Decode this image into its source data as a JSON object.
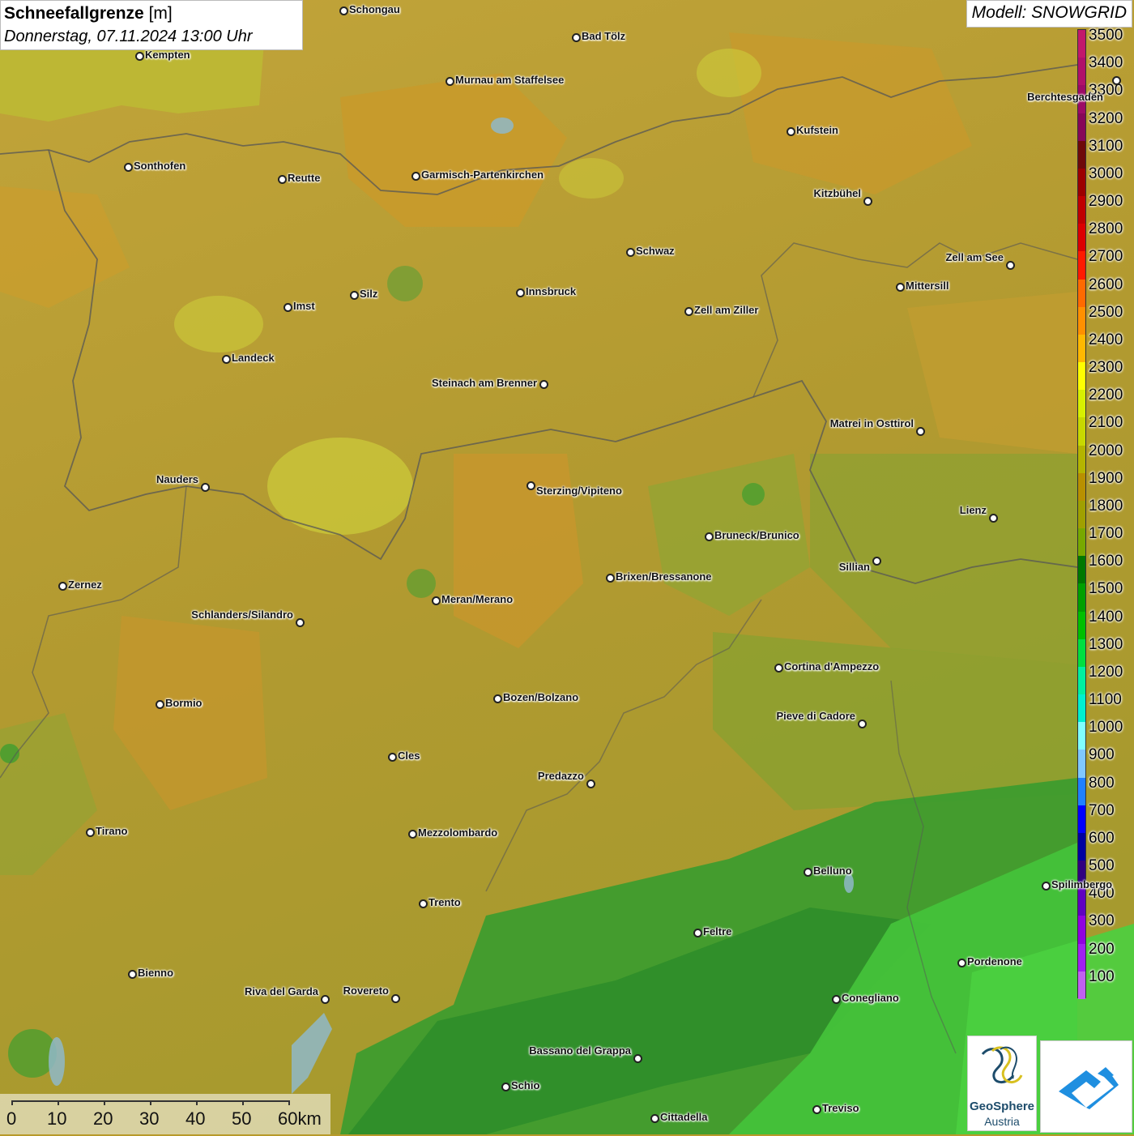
{
  "header": {
    "title_bold": "Schneefallgrenze",
    "title_unit": " [m]",
    "subtitle": "Donnerstag, 07.11.2024 13:00 Uhr",
    "model": "Modell: SNOWGRID"
  },
  "legend": {
    "levels": [
      {
        "label": "3500",
        "color": "#c2186b"
      },
      {
        "label": "3400",
        "color": "#b0106a"
      },
      {
        "label": "3300",
        "color": "#9c0a66"
      },
      {
        "label": "3200",
        "color": "#860658"
      },
      {
        "label": "3100",
        "color": "#6e0a0a"
      },
      {
        "label": "3000",
        "color": "#9c0000"
      },
      {
        "label": "2900",
        "color": "#c00000"
      },
      {
        "label": "2800",
        "color": "#dc0000"
      },
      {
        "label": "2700",
        "color": "#ff1a00"
      },
      {
        "label": "2600",
        "color": "#ff6a00"
      },
      {
        "label": "2500",
        "color": "#ff9000"
      },
      {
        "label": "2400",
        "color": "#ffb800"
      },
      {
        "label": "2300",
        "color": "#ffff00"
      },
      {
        "label": "2200",
        "color": "#d8f000"
      },
      {
        "label": "2100",
        "color": "#c8d800"
      },
      {
        "label": "2000",
        "color": "#b4b400"
      },
      {
        "label": "1900",
        "color": "#b89000"
      },
      {
        "label": "1800",
        "color": "#a0a000"
      },
      {
        "label": "1700",
        "color": "#78a800"
      },
      {
        "label": "1600",
        "color": "#007800"
      },
      {
        "label": "1500",
        "color": "#00a000"
      },
      {
        "label": "1400",
        "color": "#00c000"
      },
      {
        "label": "1300",
        "color": "#00e040"
      },
      {
        "label": "1200",
        "color": "#00f0a0"
      },
      {
        "label": "1100",
        "color": "#00f0d0"
      },
      {
        "label": "1000",
        "color": "#80ffff"
      },
      {
        "label": "900",
        "color": "#80c8ff"
      },
      {
        "label": "800",
        "color": "#2080ff"
      },
      {
        "label": "700",
        "color": "#0000ff"
      },
      {
        "label": "600",
        "color": "#0000a0"
      },
      {
        "label": "500",
        "color": "#300080"
      },
      {
        "label": "400",
        "color": "#6000c0"
      },
      {
        "label": "300",
        "color": "#9000e0"
      },
      {
        "label": "200",
        "color": "#a020f0"
      },
      {
        "label": "100",
        "color": "#c060f0"
      }
    ]
  },
  "cities": [
    {
      "name": "Schongau"
    },
    {
      "name": "Bad Tölz"
    },
    {
      "name": "Kempten"
    },
    {
      "name": "Murnau am Staffelsee"
    },
    {
      "name": "Berchtesgaden"
    },
    {
      "name": "Kufstein"
    },
    {
      "name": "Sonthofen"
    },
    {
      "name": "Reutte"
    },
    {
      "name": "Garmisch-Partenkirchen"
    },
    {
      "name": "Kitzbühel"
    },
    {
      "name": "Schwaz"
    },
    {
      "name": "Zell am See"
    },
    {
      "name": "Innsbruck"
    },
    {
      "name": "Silz"
    },
    {
      "name": "Mittersill"
    },
    {
      "name": "Imst"
    },
    {
      "name": "Zell am Ziller"
    },
    {
      "name": "Landeck"
    },
    {
      "name": "Steinach am Brenner"
    },
    {
      "name": "Matrei in Osttirol"
    },
    {
      "name": "Nauders"
    },
    {
      "name": "Sterzing/Vipiteno"
    },
    {
      "name": "Lienz"
    },
    {
      "name": "Bruneck/Brunico"
    },
    {
      "name": "Sillian"
    },
    {
      "name": "Brixen/Bressanone"
    },
    {
      "name": "Zernez"
    },
    {
      "name": "Meran/Merano"
    },
    {
      "name": "Schlanders/Silandro"
    },
    {
      "name": "Cortina d'Ampezzo"
    },
    {
      "name": "Bozen/Bolzano"
    },
    {
      "name": "Bormio"
    },
    {
      "name": "Pieve di Cadore"
    },
    {
      "name": "Cles"
    },
    {
      "name": "Predazzo"
    },
    {
      "name": "Tirano"
    },
    {
      "name": "Mezzolombardo"
    },
    {
      "name": "Belluno"
    },
    {
      "name": "Spilimbergo"
    },
    {
      "name": "Trento"
    },
    {
      "name": "Feltre"
    },
    {
      "name": "Pordenone"
    },
    {
      "name": "Bienno"
    },
    {
      "name": "Riva del Garda"
    },
    {
      "name": "Rovereto"
    },
    {
      "name": "Conegliano"
    },
    {
      "name": "Bassano del Grappa"
    },
    {
      "name": "Schio"
    },
    {
      "name": "Treviso"
    },
    {
      "name": "Cittadella"
    }
  ],
  "scale": {
    "labels": [
      "0",
      "10",
      "20",
      "30",
      "40",
      "50",
      "60km"
    ]
  },
  "logos": {
    "geosphere_line1": "GeoSphere",
    "geosphere_line2": "Austria"
  }
}
